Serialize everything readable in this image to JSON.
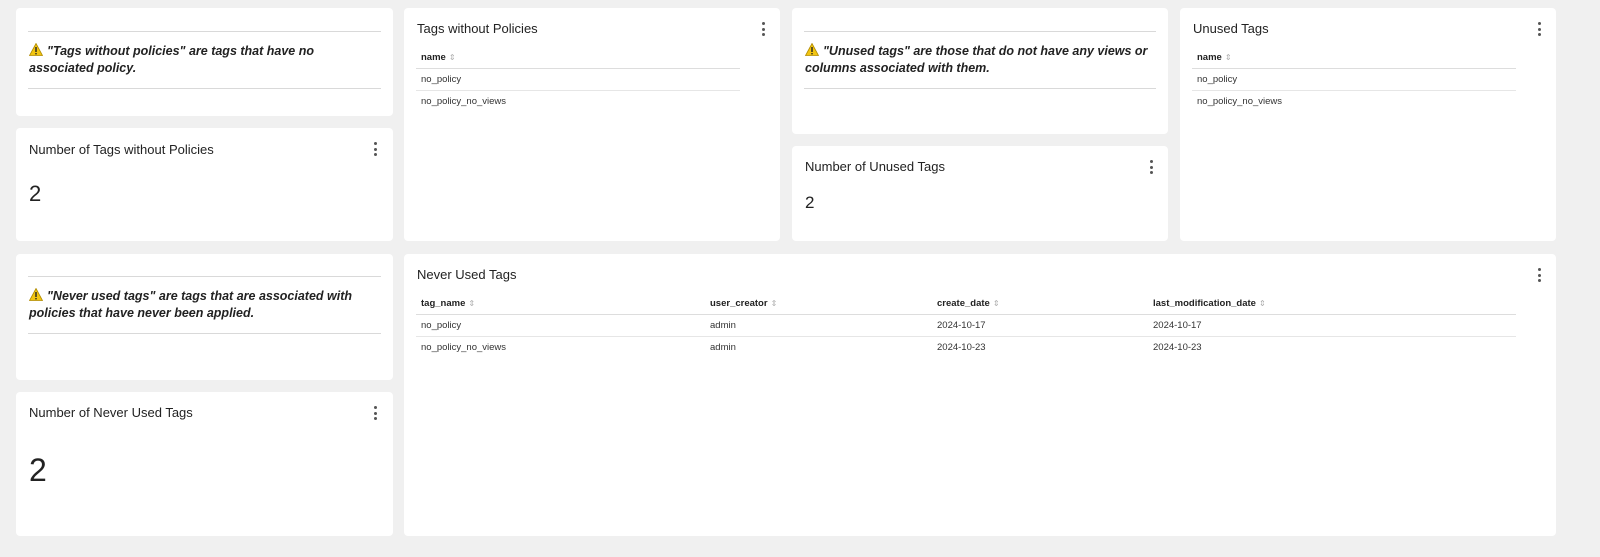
{
  "notes": {
    "no_policy": "\"Tags without policies\" are tags that have no associated policy.",
    "unused": "\"Unused tags\" are those that do not have any views or columns associated with them.",
    "never_used": "\"Never used tags\" are tags that are associated with policies that have never been applied."
  },
  "metrics": {
    "no_policy": {
      "title": "Number of Tags without Policies",
      "value": "2"
    },
    "unused": {
      "title": "Number of Unused Tags",
      "value": "2"
    },
    "never_used": {
      "title": "Number of Never Used Tags",
      "value": "2"
    }
  },
  "tables": {
    "no_policy": {
      "title": "Tags without Policies",
      "columns": [
        "name"
      ],
      "rows": [
        [
          "no_policy"
        ],
        [
          "no_policy_no_views"
        ]
      ]
    },
    "unused": {
      "title": "Unused Tags",
      "columns": [
        "name"
      ],
      "rows": [
        [
          "no_policy"
        ],
        [
          "no_policy_no_views"
        ]
      ]
    },
    "never_used": {
      "title": "Never Used Tags",
      "columns": [
        "tag_name",
        "user_creator",
        "create_date",
        "last_modification_date"
      ],
      "rows": [
        [
          "no_policy",
          "admin",
          "2024-10-17",
          "2024-10-17"
        ],
        [
          "no_policy_no_views",
          "admin",
          "2024-10-23",
          "2024-10-23"
        ]
      ]
    }
  },
  "icons": {
    "warning": "warning-icon",
    "menu": "kebab-menu-icon",
    "sort": "sort-icon"
  },
  "colors": {
    "background": "#f0f0f0",
    "card": "#ffffff",
    "warning": "#f2c511"
  }
}
